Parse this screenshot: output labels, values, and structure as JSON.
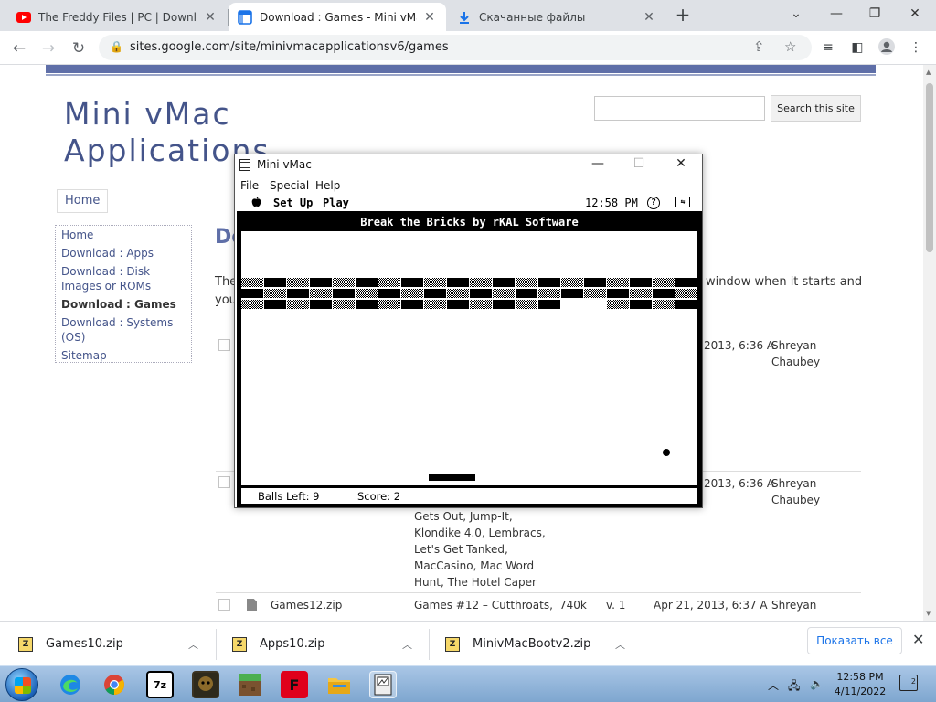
{
  "browser": {
    "tabs": [
      {
        "title": "The Freddy Files | PC | Download",
        "icon": "youtube-icon"
      },
      {
        "title": "Download : Games - Mini vMac A",
        "icon": "google-sites-icon"
      },
      {
        "title": "Скачанные файлы",
        "icon": "download-icon"
      }
    ],
    "url": "sites.google.com/site/minivmacapplicationsv6/games"
  },
  "site": {
    "title_line1": "Mini vMac",
    "title_line2": "Applications",
    "search_button": "Search this site",
    "search_placeholder": "",
    "home_button": "Home",
    "nav": [
      {
        "label": "Home"
      },
      {
        "label": "Download : Apps"
      },
      {
        "label": "Download : Disk Images or ROMs"
      },
      {
        "label": "Download : Games"
      },
      {
        "label": "Download : Systems (OS)"
      },
      {
        "label": "Sitemap"
      }
    ],
    "heading_partial": "Do",
    "para_left_line1": "The",
    "para_right": "window when it starts and",
    "para_left_line2": "you",
    "rows": [
      {
        "date": "2013, 6:36 A",
        "author1": "Shreyan",
        "author2": "Chaubey"
      },
      {
        "date": "2013, 6:36 A",
        "author1": "Shreyan",
        "author2": "Chaubey",
        "desc": [
          "Gets Out, Jump-It,",
          "Klondike 4.0, Lembracs,",
          "Let's Get Tanked,",
          "MacCasino, Mac Word",
          "Hunt, The Hotel Caper"
        ]
      },
      {
        "name": "Games12.zip",
        "desc": "Games #12 – Cutthroats,",
        "size": "740k",
        "version": "v. 1",
        "date": "Apr 21, 2013, 6:37 A",
        "author1": "Shreyan"
      }
    ]
  },
  "minivmac": {
    "window_title": "Mini vMac",
    "menu": [
      "File",
      "Special",
      "Help"
    ],
    "mac_menu": {
      "apple": "",
      "setup": "Set Up",
      "play": "Play",
      "time": "12:58 PM",
      "help": "?"
    },
    "game_title": "Break the Bricks by rKAL Software",
    "balls_left": "Balls Left: 9",
    "score": "Score: 2",
    "bricks": [
      "cscscscscscscscscscs",
      "scscscscscscscscscsc",
      "cscscscscscscs..cscs"
    ]
  },
  "downloads": {
    "items": [
      {
        "name": "Games10.zip"
      },
      {
        "name": "Apps10.zip"
      },
      {
        "name": "MinivMacBootv2.zip"
      }
    ],
    "show_all": "Показать все"
  },
  "taskbar": {
    "time": "12:58 PM",
    "date": "4/11/2022",
    "notif_count": "2",
    "apps": [
      {
        "icon": "edge-icon"
      },
      {
        "icon": "chrome-icon"
      },
      {
        "icon": "7zip-icon",
        "label": "7z"
      },
      {
        "icon": "fnaf-game-icon"
      },
      {
        "icon": "minecraft-icon"
      },
      {
        "icon": "flash-icon",
        "label": "F"
      },
      {
        "icon": "file-explorer-icon"
      },
      {
        "icon": "minivmac-icon"
      }
    ]
  }
}
